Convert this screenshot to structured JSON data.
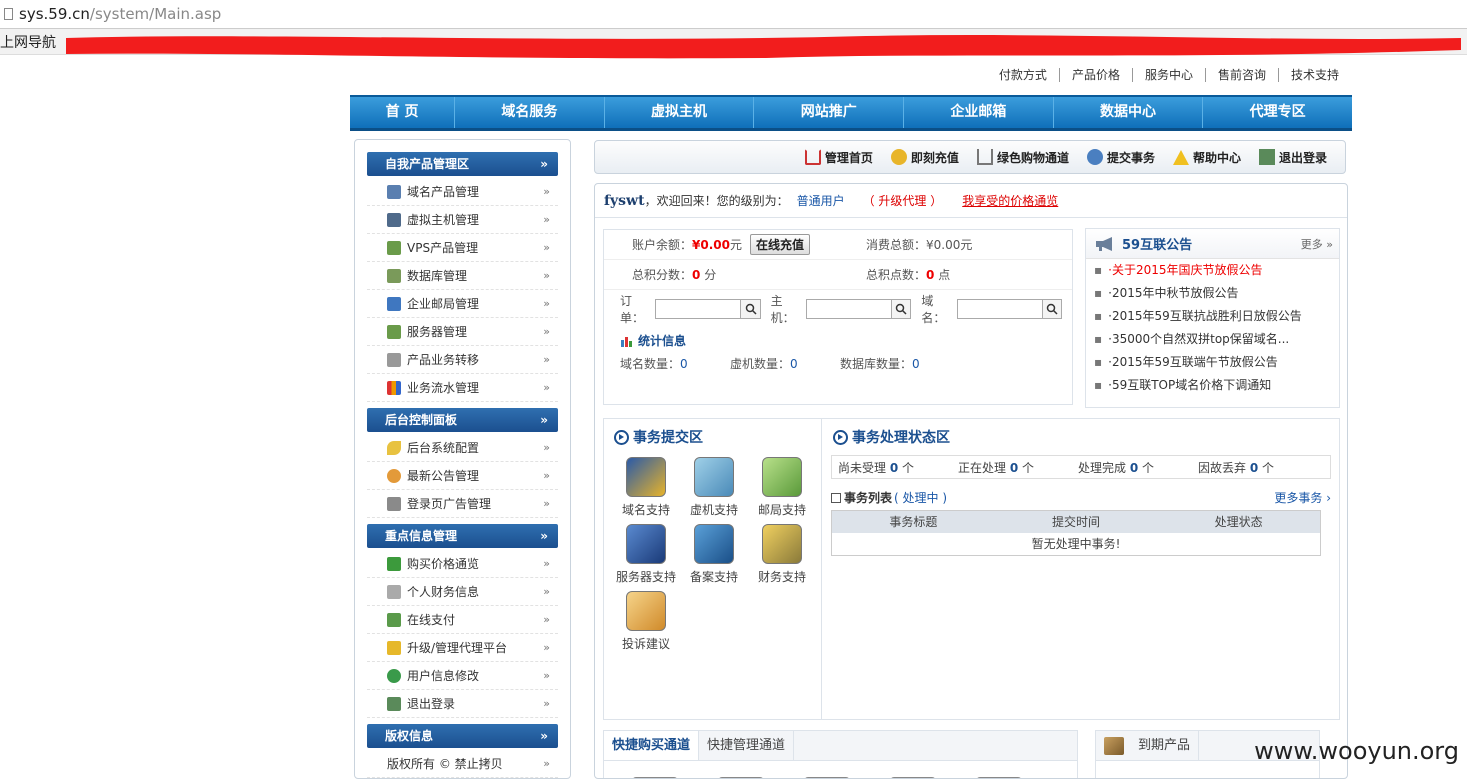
{
  "browser": {
    "host": "sys.59.cn",
    "path": "/system/Main.asp",
    "bookmark": "上网导航"
  },
  "top_links": [
    "付款方式",
    "产品价格",
    "服务中心",
    "售前咨询",
    "技术支持"
  ],
  "nav": [
    "首 页",
    "域名服务",
    "虚拟主机",
    "网站推广",
    "企业邮箱",
    "数据中心",
    "代理专区"
  ],
  "sidebar": [
    {
      "title": "自我产品管理区",
      "items": [
        "域名产品管理",
        "虚拟主机管理",
        "VPS产品管理",
        "数据库管理",
        "企业邮局管理",
        "服务器管理",
        "产品业务转移",
        "业务流水管理"
      ]
    },
    {
      "title": "后台控制面板",
      "items": [
        "后台系统配置",
        "最新公告管理",
        "登录页广告管理"
      ]
    },
    {
      "title": "重点信息管理",
      "items": [
        "购买价格通览",
        "个人财务信息",
        "在线支付",
        "升级/管理代理平台",
        "用户信息修改",
        "退出登录"
      ]
    },
    {
      "title": "版权信息",
      "items": [
        "版权所有 © 禁止拷贝"
      ]
    }
  ],
  "toolbar": [
    "管理首页",
    "即刻充值",
    "绿色购物通道",
    "提交事务",
    "帮助中心",
    "退出登录"
  ],
  "welcome": {
    "user": "fyswt",
    "text": "，欢迎回来！您的级别为：",
    "level": "普通用户",
    "upgrade": "（ 升级代理 ）",
    "price_link": "我享受的价格通览"
  },
  "account": {
    "balance_label": "账户余额：",
    "balance": "¥0.00",
    "balance_unit": "元",
    "recharge": "在线充值",
    "spent_label": "消费总额：",
    "spent": "¥0.00元",
    "points_label": "总积分数：",
    "points": "0",
    "points_unit": " 分",
    "total_points_label": "总积点数：",
    "total_points": "0",
    "total_points_unit": " 点",
    "order_label": "订单：",
    "host_label": "主机：",
    "domain_label": "域名："
  },
  "stats": {
    "title": "统计信息",
    "domain_label": "域名数量：",
    "domain": "0",
    "vhost_label": "虚机数量：",
    "vhost": "0",
    "db_label": "数据库数量：",
    "db": "0"
  },
  "notice": {
    "title": "59互联公告",
    "more": "更多",
    "items": [
      "·关于2015年国庆节放假公告",
      "·2015年中秋节放假公告",
      "·2015年59互联抗战胜利日放假公告",
      "·35000个自然双拼top保留域名...",
      "·2015年59互联端午节放假公告",
      "·59互联TOP域名价格下调通知"
    ]
  },
  "affairs_submit": {
    "title": "事务提交区",
    "items": [
      "域名支持",
      "虚机支持",
      "邮局支持",
      "服务器支持",
      "备案支持",
      "财务支持",
      "投诉建议"
    ]
  },
  "affairs_status": {
    "title": "事务处理状态区",
    "states": [
      {
        "label": "尚未受理",
        "count": "0",
        "unit": " 个"
      },
      {
        "label": "正在处理",
        "count": "0",
        "unit": " 个"
      },
      {
        "label": "处理完成",
        "count": "0",
        "unit": " 个"
      },
      {
        "label": "因故丢弃",
        "count": "0",
        "unit": " 个"
      }
    ],
    "list_title": "事务列表",
    "list_sub": "( 处理中 )",
    "more": "更多事务",
    "columns": [
      "事务标题",
      "提交时间",
      "处理状态"
    ],
    "empty": "暂无处理中事务!"
  },
  "quick": {
    "tabs": [
      "快捷购买通道",
      "快捷管理通道"
    ]
  },
  "expire": {
    "title": "到期产品"
  },
  "watermark": "www.wooyun.org",
  "colors": {
    "nav": "#1a7cc6",
    "side_head": "#245f9f",
    "accent_red": "#e00000"
  }
}
